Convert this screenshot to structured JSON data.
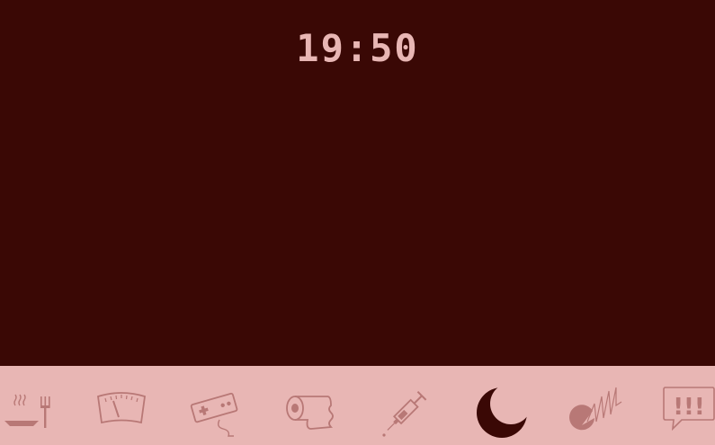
{
  "clock": {
    "time": "19:50"
  },
  "colors": {
    "screen": "#3a0805",
    "bar": "#e8b6b4",
    "icon": "#b87876",
    "text": "#e8b6b4"
  },
  "toolbar": {
    "items": [
      {
        "icon": "food-icon",
        "active": false
      },
      {
        "icon": "scale-icon",
        "active": false
      },
      {
        "icon": "game-controller-icon",
        "active": false
      },
      {
        "icon": "toilet-paper-icon",
        "active": false
      },
      {
        "icon": "syringe-icon",
        "active": false
      },
      {
        "icon": "moon-icon",
        "active": true
      },
      {
        "icon": "stats-icon",
        "active": false
      },
      {
        "icon": "alert-icon",
        "active": false,
        "label": "!!!"
      }
    ]
  }
}
